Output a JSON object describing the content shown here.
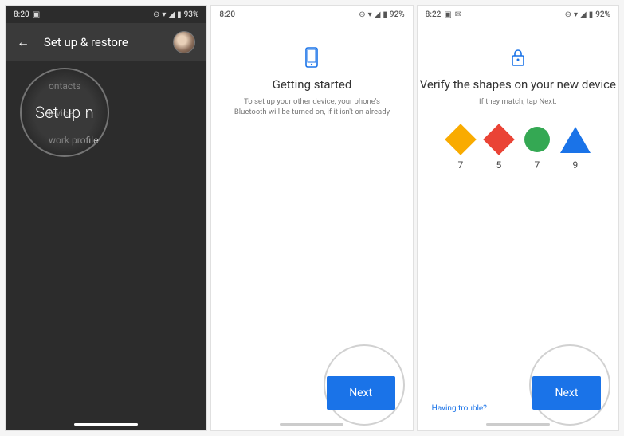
{
  "panel1": {
    "status": {
      "time": "8:20",
      "battery": "93%"
    },
    "appbar_title": "Set up & restore",
    "highlight_label": "Set up n",
    "settings_items": [
      "ontacts",
      "levice",
      "work profile"
    ]
  },
  "panel2": {
    "status": {
      "time": "8:20",
      "battery": "92%"
    },
    "title": "Getting started",
    "subtitle": "To set up your other device, your phone's Bluetooth will be turned on, if it isn't on already",
    "next_label": "Next"
  },
  "panel3": {
    "status": {
      "time": "8:22",
      "battery": "92%"
    },
    "title": "Verify the shapes on your new device",
    "subtitle": "If they match, tap Next.",
    "shapes": [
      {
        "type": "diamond",
        "color": "#f9ab00",
        "value": "7"
      },
      {
        "type": "diamond",
        "color": "#ea4335",
        "value": "5"
      },
      {
        "type": "circle",
        "color": "#34a853",
        "value": "7"
      },
      {
        "type": "triangle",
        "color": "#1a73e8",
        "value": "9"
      }
    ],
    "help_label": "Having trouble?",
    "next_label": "Next"
  },
  "icons": {
    "phone_icon_color": "#1a73e8",
    "lock_icon_color": "#1a73e8"
  }
}
